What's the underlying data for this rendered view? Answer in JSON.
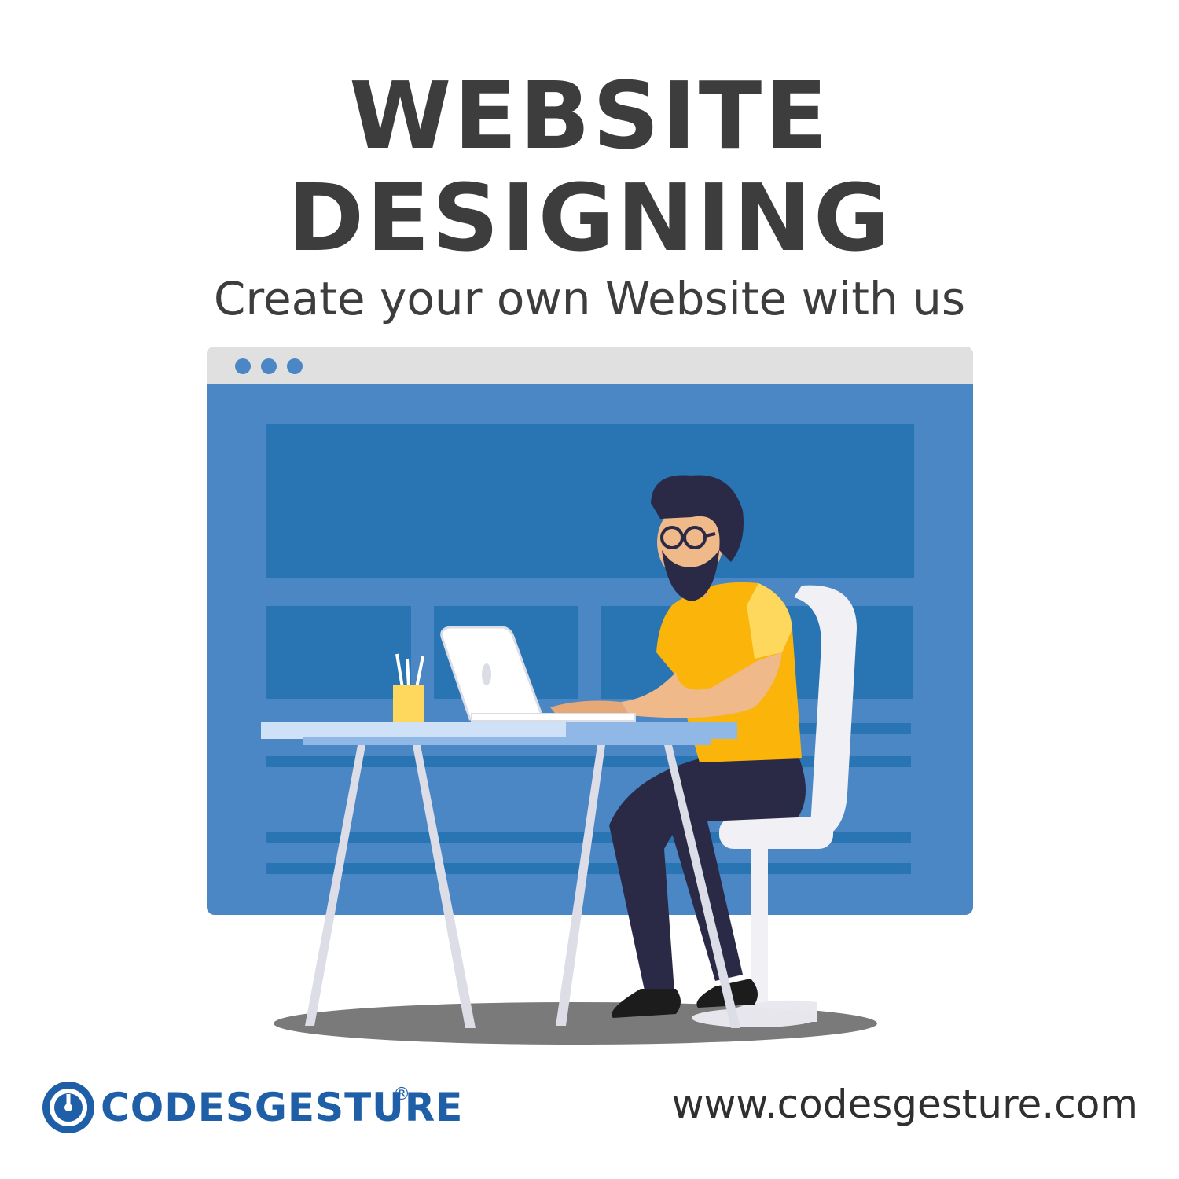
{
  "headline": {
    "line1": "WEBSITE",
    "line2": "DESIGNING",
    "subtitle": "Create your own Website with us"
  },
  "colors": {
    "heading": "#3d3d3d",
    "browser_frame": "#4b86c5",
    "browser_bar": "#e0e0e0",
    "browser_block": "#2974b3",
    "brand_blue": "#1f5fa8",
    "shirt": "#fbb40a"
  },
  "illustration": {
    "icons": [
      "browser-window-icon",
      "designer-person-icon",
      "laptop-icon",
      "desk-icon",
      "chair-icon",
      "pencil-cup-icon"
    ]
  },
  "footer": {
    "brand_name": "CODESGESTURE",
    "brand_reg": "®",
    "website": "www.codesgesture.com",
    "logo_icon": "codesgesture-logo-icon"
  }
}
